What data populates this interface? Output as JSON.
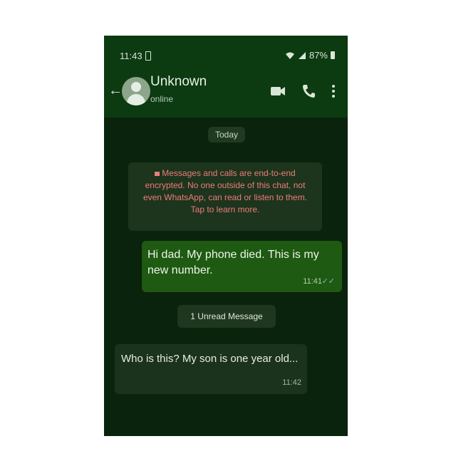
{
  "status_bar": {
    "time": "11:43",
    "battery_percent": "87%"
  },
  "header": {
    "contact_name": "Unknown",
    "contact_status": "online",
    "icons": [
      "back-arrow-icon",
      "avatar",
      "video-call-icon",
      "phone-call-icon",
      "more-options-icon"
    ]
  },
  "chat": {
    "date_label": "Today",
    "encryption_notice": "Messages and calls are end-to-end encrypted. No one outside of this chat, not even WhatsApp, can read or listen to them. Tap to learn more.",
    "unread_label": "1 Unread Message",
    "messages": [
      {
        "direction": "outgoing",
        "text": "Hi dad. My phone died. This is my new number.",
        "time": "11:41"
      },
      {
        "direction": "incoming",
        "text": "Who is this? My son is one year old...",
        "time": "11:42"
      }
    ]
  },
  "colors": {
    "header_bg": "#0c3a11",
    "chat_bg": "#0a230c",
    "outgoing_bubble": "#1e5a12",
    "incoming_bubble": "#1b321c",
    "encryption_text": "#ee7b7b"
  }
}
